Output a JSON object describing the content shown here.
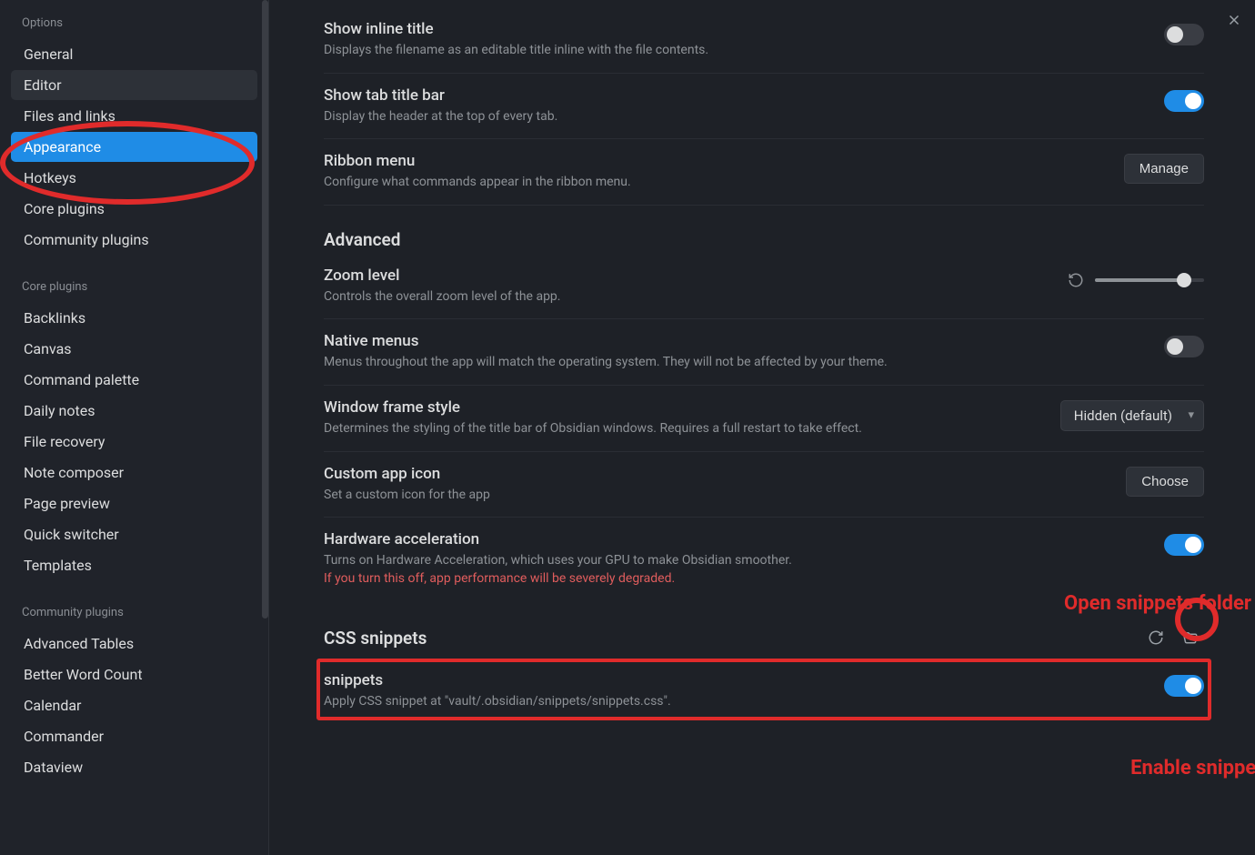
{
  "sidebar": {
    "sections": [
      {
        "header": "Options",
        "items": [
          {
            "label": "General"
          },
          {
            "label": "Editor",
            "state": "hover"
          },
          {
            "label": "Files and links"
          },
          {
            "label": "Appearance",
            "state": "active"
          },
          {
            "label": "Hotkeys"
          },
          {
            "label": "Core plugins"
          },
          {
            "label": "Community plugins"
          }
        ]
      },
      {
        "header": "Core plugins",
        "items": [
          {
            "label": "Backlinks"
          },
          {
            "label": "Canvas"
          },
          {
            "label": "Command palette"
          },
          {
            "label": "Daily notes"
          },
          {
            "label": "File recovery"
          },
          {
            "label": "Note composer"
          },
          {
            "label": "Page preview"
          },
          {
            "label": "Quick switcher"
          },
          {
            "label": "Templates"
          }
        ]
      },
      {
        "header": "Community plugins",
        "items": [
          {
            "label": "Advanced Tables"
          },
          {
            "label": "Better Word Count"
          },
          {
            "label": "Calendar"
          },
          {
            "label": "Commander"
          },
          {
            "label": "Dataview"
          }
        ]
      }
    ]
  },
  "settings": {
    "inlineTitle": {
      "title": "Show inline title",
      "desc": "Displays the filename as an editable title inline with the file contents.",
      "on": false
    },
    "tabTitleBar": {
      "title": "Show tab title bar",
      "desc": "Display the header at the top of every tab.",
      "on": true
    },
    "ribbon": {
      "title": "Ribbon menu",
      "desc": "Configure what commands appear in the ribbon menu.",
      "button": "Manage"
    },
    "advancedHeader": "Advanced",
    "zoom": {
      "title": "Zoom level",
      "desc": "Controls the overall zoom level of the app."
    },
    "nativeMenus": {
      "title": "Native menus",
      "desc": "Menus throughout the app will match the operating system. They will not be affected by your theme.",
      "on": false
    },
    "frameStyle": {
      "title": "Window frame style",
      "desc": "Determines the styling of the title bar of Obsidian windows. Requires a full restart to take effect.",
      "value": "Hidden (default)"
    },
    "appIcon": {
      "title": "Custom app icon",
      "desc": "Set a custom icon for the app",
      "button": "Choose"
    },
    "hardware": {
      "title": "Hardware acceleration",
      "desc": "Turns on Hardware Acceleration, which uses your GPU to make Obsidian smoother.",
      "warn": "If you turn this off, app performance will be severely degraded.",
      "on": true
    },
    "cssHeader": "CSS snippets",
    "snippet": {
      "title": "snippets",
      "desc": "Apply CSS snippet at \"vault/.obsidian/snippets/snippets.css\".",
      "on": true
    }
  },
  "annotations": {
    "openFolder": "Open snippets folder",
    "enable": "Enable snippets"
  }
}
